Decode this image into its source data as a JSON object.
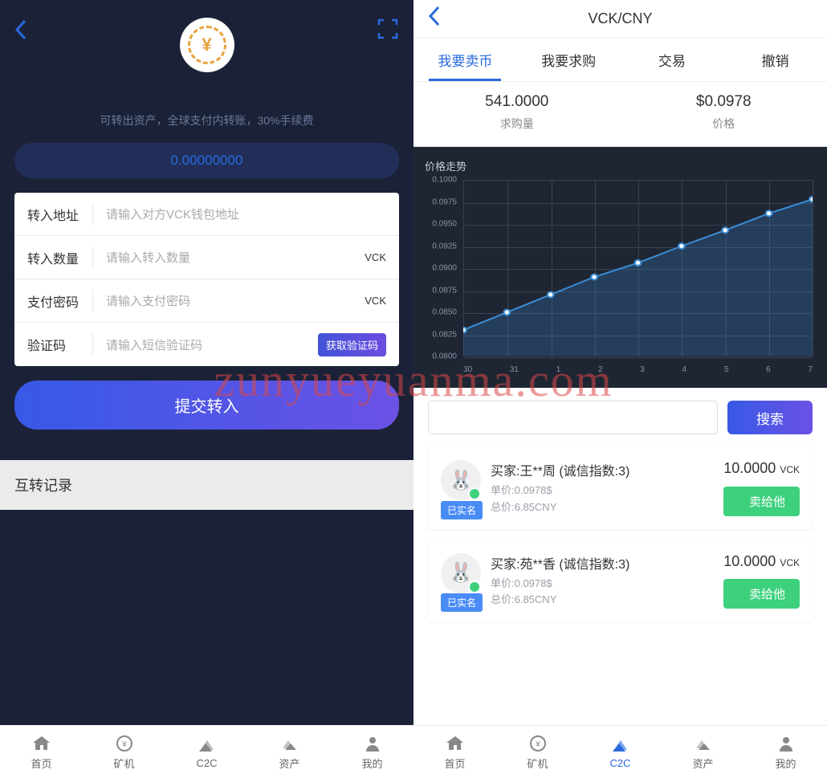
{
  "watermark": "zunyueyuanma.com",
  "left": {
    "info_text": "可转出资产，全球支付内转账，30%手续费",
    "balance": "0.00000000",
    "form": {
      "address": {
        "label": "转入地址",
        "placeholder": "请输入对方VCK钱包地址"
      },
      "amount": {
        "label": "转入数量",
        "placeholder": "请输入转入数量",
        "unit": "VCK"
      },
      "password": {
        "label": "支付密码",
        "placeholder": "请输入支付密码",
        "unit": "VCK"
      },
      "code": {
        "label": "验证码",
        "placeholder": "请输入短信验证码",
        "button": "获取验证码"
      }
    },
    "submit": "提交转入",
    "history_title": "互转记录",
    "nav": [
      "首页",
      "矿机",
      "C2C",
      "资产",
      "我的"
    ]
  },
  "right": {
    "title": "VCK/CNY",
    "tabs": [
      "我要卖币",
      "我要求购",
      "交易",
      "撤销"
    ],
    "stats": {
      "buy_amount": {
        "value": "541.0000",
        "label": "求购量"
      },
      "price": {
        "value": "$0.0978",
        "label": "价格"
      }
    },
    "chart_title": "价格走势",
    "search_btn": "搜索",
    "buyers": [
      {
        "name": "买家:王**周  (诚信指数:3)",
        "unit_price": "单价:0.0978$",
        "total": "总价:6.85CNY",
        "verified": "已实名",
        "amount": "10.0000",
        "amount_unit": "VCK",
        "action": "卖给他"
      },
      {
        "name": "买家:苑**香  (诚信指数:3)",
        "unit_price": "单价:0.0978$",
        "total": "总价:6.85CNY",
        "verified": "已实名",
        "amount": "10.0000",
        "amount_unit": "VCK",
        "action": "卖给他"
      }
    ],
    "nav": [
      "首页",
      "矿机",
      "C2C",
      "资产",
      "我的"
    ]
  },
  "chart_data": {
    "type": "line",
    "title": "价格走势",
    "xlabel": "",
    "ylabel": "",
    "ylim": [
      0.08,
      0.1
    ],
    "y_ticks": [
      "0.1000",
      "0.0975",
      "0.0950",
      "0.0925",
      "0.0900",
      "0.0875",
      "0.0850",
      "0.0825",
      "0.0800"
    ],
    "x_ticks": [
      "30",
      "31",
      "1",
      "2",
      "3",
      "4",
      "5",
      "6",
      "7"
    ],
    "categories": [
      "30",
      "31",
      "1",
      "2",
      "3",
      "4",
      "5",
      "6",
      "7"
    ],
    "values": [
      0.083,
      0.085,
      0.087,
      0.089,
      0.0906,
      0.0925,
      0.0943,
      0.0962,
      0.0978
    ]
  }
}
